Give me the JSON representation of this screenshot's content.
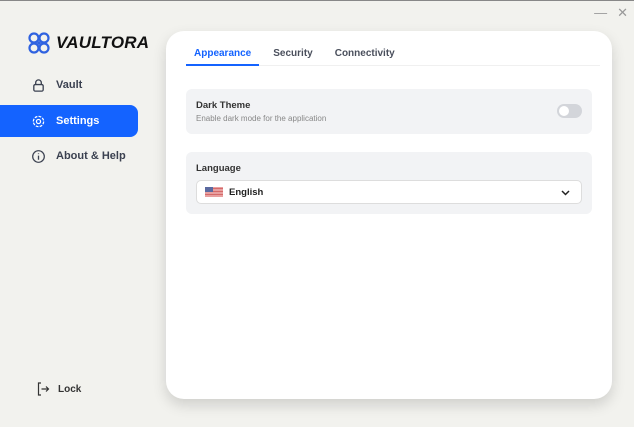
{
  "window": {
    "minimize": "—",
    "close": "✕"
  },
  "brand": {
    "name": "VAULTORA"
  },
  "sidebar": {
    "items": [
      {
        "label": "Vault",
        "icon": "lock-icon"
      },
      {
        "label": "Settings",
        "icon": "gear-icon"
      },
      {
        "label": "About & Help",
        "icon": "info-icon"
      }
    ],
    "lock_label": "Lock"
  },
  "tabs": [
    "Appearance",
    "Security",
    "Connectivity"
  ],
  "dark_theme": {
    "title": "Dark Theme",
    "description": "Enable dark mode for the application",
    "enabled": false
  },
  "language": {
    "label": "Language",
    "value": "English"
  },
  "colors": {
    "accent": "#1463ff",
    "background": "#f2f2ee"
  }
}
